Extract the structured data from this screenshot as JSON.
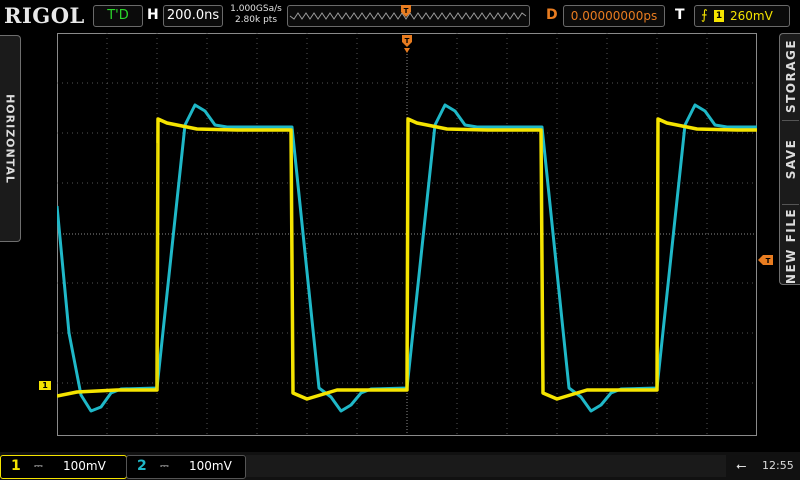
{
  "header": {
    "logo": "RIGOL",
    "run_state": "T'D",
    "h_label": "H",
    "timebase": "200.0ns",
    "sample_rate": "1.000GSa/s",
    "memory_depth": "2.80k pts",
    "memory_marker": "T",
    "d_label": "D",
    "delay": "0.00000000ps",
    "t_label": "T",
    "trigger_source": "1",
    "trigger_level": "260mV"
  },
  "side_left": {
    "label": "HORIZONTAL"
  },
  "side_right": {
    "items": [
      "STORAGE",
      "SAVE",
      "NEW FILE"
    ]
  },
  "markers": {
    "trigger_pos": "T",
    "ch1": "1",
    "trigger_level": "T"
  },
  "footer": {
    "ch1": {
      "number": "1",
      "coupling": "⎓",
      "scale": "100mV"
    },
    "ch2": {
      "number": "2",
      "coupling": "⎓",
      "scale": "100mV"
    },
    "time": "12:55"
  },
  "colors": {
    "ch1": "#f5e400",
    "ch2": "#1fb8c8",
    "delay": "#e87c20",
    "run_state": "#2ad62a"
  }
}
